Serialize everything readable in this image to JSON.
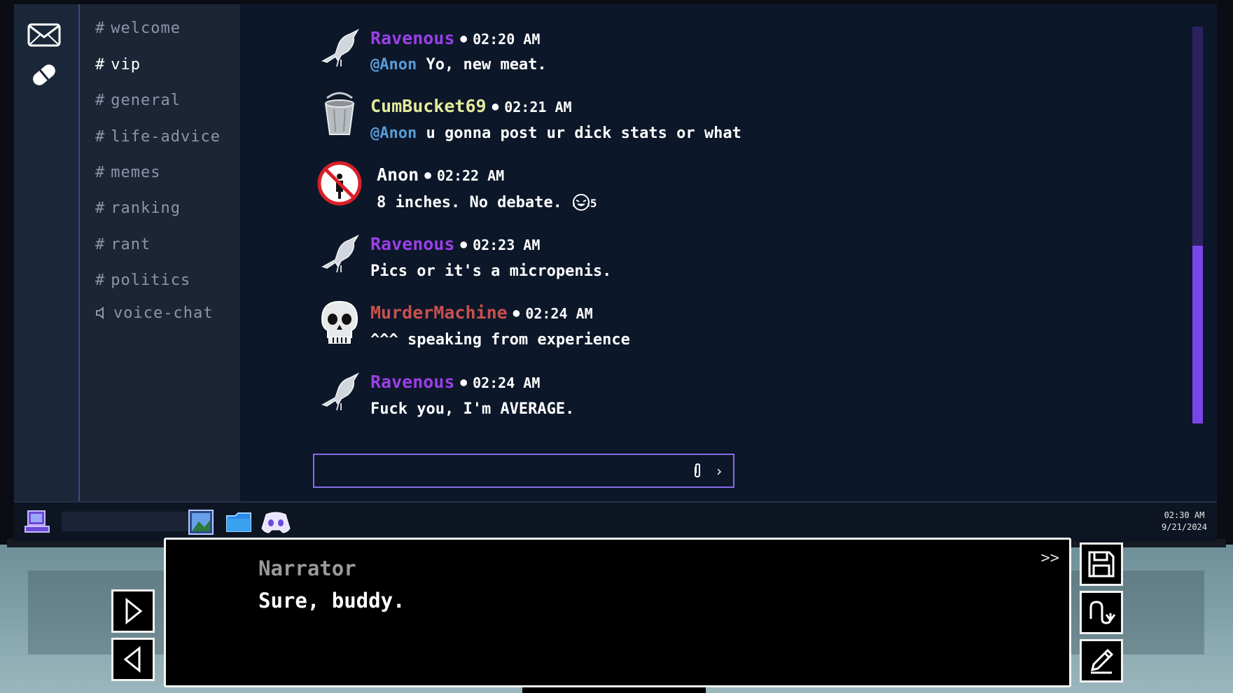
{
  "channels": [
    {
      "label": "welcome",
      "icon": "#"
    },
    {
      "label": "vip",
      "icon": "#",
      "active": true
    },
    {
      "label": "general",
      "icon": "#"
    },
    {
      "label": "life-advice",
      "icon": "#"
    },
    {
      "label": "memes",
      "icon": "#"
    },
    {
      "label": "ranking",
      "icon": "#"
    },
    {
      "label": "rant",
      "icon": "#"
    },
    {
      "label": "politics",
      "icon": "#"
    },
    {
      "label": "voice-chat",
      "icon": "speaker-icon"
    }
  ],
  "messages": [
    {
      "user": "Ravenous",
      "color": "#9b3fe8",
      "avatar": "crow-icon",
      "time": "02:20 AM",
      "mention": "@Anon",
      "text": "Yo, new meat."
    },
    {
      "user": "CumBucket69",
      "color": "#e4ea9a",
      "avatar": "bucket-icon",
      "time": "02:21 AM",
      "mention": "@Anon",
      "text": "u gonna post ur dick stats or what"
    },
    {
      "user": "Anon",
      "color": "#ffffff",
      "avatar": "no-entry-icon",
      "time": "02:22 AM",
      "text": "8 inches. No debate.",
      "reaction_count": "5"
    },
    {
      "user": "Ravenous",
      "color": "#9b3fe8",
      "avatar": "crow-icon",
      "time": "02:23 AM",
      "text": "Pics or it's a micropenis."
    },
    {
      "user": "MurderMachine",
      "color": "#c9504e",
      "avatar": "skull-icon",
      "time": "02:24 AM",
      "text": "^^^ speaking from experience"
    },
    {
      "user": "Ravenous",
      "color": "#9b3fe8",
      "avatar": "crow-icon",
      "time": "02:24 AM",
      "text": "Fuck you, I'm AVERAGE."
    }
  ],
  "taskbar": {
    "time": "02:30 AM",
    "date": "9/21/2024"
  },
  "dialogue": {
    "speaker": "Narrator",
    "line": "Sure, buddy.",
    "skip": ">>"
  },
  "colors": {
    "accent": "#7a45e8",
    "mention": "#5b9bd5",
    "screen_bg": "#0c1729"
  }
}
